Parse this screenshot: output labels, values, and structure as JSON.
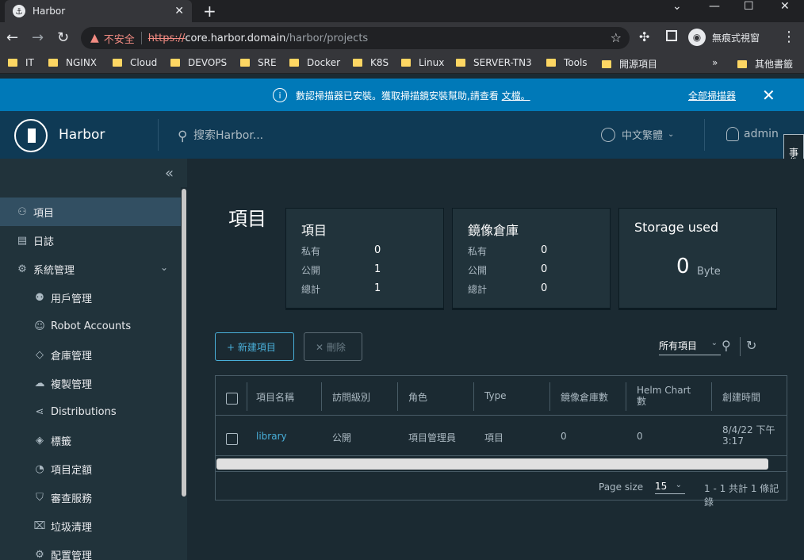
{
  "browser": {
    "tab_title": "Harbor",
    "tab_close": "✕",
    "new_tab": "+",
    "window_minimize": "—",
    "window_maximize": "☐",
    "window_close": "✕",
    "insecure_label": "不安全",
    "url_scheme": "https://",
    "url_host": "core.harbor.domain",
    "url_path": "/harbor/projects",
    "incognito_label": "無痕式視窗",
    "bookmarks": [
      "IT",
      "NGINX",
      "Cloud",
      "DEVOPS",
      "SRE",
      "Docker",
      "K8S",
      "Linux",
      "SERVER-TN3",
      "Tools",
      "開源項目"
    ],
    "bookmarks_more": "»",
    "other_bookmarks": "其他書籤"
  },
  "banner": {
    "text": "數認掃描器已安裝。獲取掃描鏡安裝幫助,請查看",
    "link": "文檔。",
    "action": "全部掃描器",
    "close": "✕"
  },
  "header": {
    "brand": "Harbor",
    "search_placeholder": "搜索Harbor...",
    "language": "中文繁體",
    "user": "admin",
    "event_tab": "事件日誌"
  },
  "sidebar": {
    "items": [
      {
        "label": "項目",
        "icon": "projects-icon"
      },
      {
        "label": "日誌",
        "icon": "logs-icon"
      },
      {
        "label": "系統管理",
        "icon": "admin-icon"
      }
    ],
    "sub_items": [
      {
        "label": "用戶管理",
        "icon": "users-icon"
      },
      {
        "label": "Robot Accounts",
        "icon": "robot-icon"
      },
      {
        "label": "倉庫管理",
        "icon": "registry-icon"
      },
      {
        "label": "複製管理",
        "icon": "replication-icon"
      },
      {
        "label": "Distributions",
        "icon": "distribution-icon"
      },
      {
        "label": "標籤",
        "icon": "tag-icon"
      },
      {
        "label": "項目定額",
        "icon": "quota-icon"
      },
      {
        "label": "審查服務",
        "icon": "shield-icon"
      },
      {
        "label": "垃圾清理",
        "icon": "trash-icon"
      },
      {
        "label": "配置管理",
        "icon": "gear-icon"
      }
    ]
  },
  "main": {
    "title": "項目",
    "cards": {
      "projects": {
        "title": "項目",
        "private_label": "私有",
        "private": "0",
        "public_label": "公開",
        "public": "1",
        "total_label": "總計",
        "total": "1"
      },
      "repos": {
        "title": "鏡像倉庫",
        "private_label": "私有",
        "private": "0",
        "public_label": "公開",
        "public": "0",
        "total_label": "總計",
        "total": "0"
      },
      "storage": {
        "title": "Storage used",
        "value": "0",
        "unit": "Byte"
      }
    },
    "new_button": "+ 新建項目",
    "delete_button": "✕ 刪除",
    "filter_label": "所有項目",
    "table": {
      "headers": [
        "項目名稱",
        "訪問級別",
        "角色",
        "Type",
        "鏡像倉庫數",
        "Helm Chart 數",
        "創建時間"
      ],
      "rows": [
        {
          "name": "library",
          "access": "公開",
          "role": "項目管理員",
          "type": "項目",
          "repos": "0",
          "charts": "0",
          "created": "8/4/22 下午 3:17"
        }
      ],
      "page_size_label": "Page size",
      "page_size": "15",
      "page_count": "1 - 1 共計 1 條記錄"
    }
  }
}
